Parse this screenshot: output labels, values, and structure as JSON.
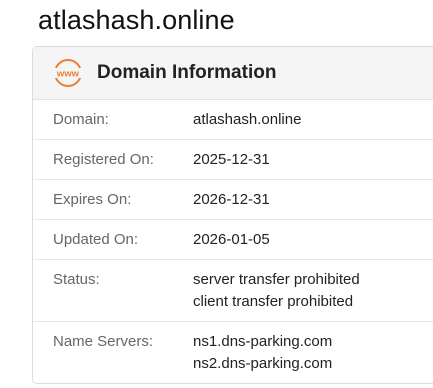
{
  "page": {
    "title": "atlashash.online"
  },
  "card": {
    "icon": "www-globe-icon",
    "icon_text": "www",
    "title": "Domain Information",
    "accent_color": "#e8803a"
  },
  "rows": [
    {
      "label": "Domain:",
      "values": [
        "atlashash.online"
      ]
    },
    {
      "label": "Registered On:",
      "values": [
        "2025-12-31"
      ]
    },
    {
      "label": "Expires On:",
      "values": [
        "2026-12-31"
      ]
    },
    {
      "label": "Updated On:",
      "values": [
        "2026-01-05"
      ]
    },
    {
      "label": "Status:",
      "values": [
        "server transfer prohibited",
        "client transfer prohibited"
      ]
    },
    {
      "label": "Name Servers:",
      "values": [
        "ns1.dns-parking.com",
        "ns2.dns-parking.com"
      ]
    }
  ]
}
